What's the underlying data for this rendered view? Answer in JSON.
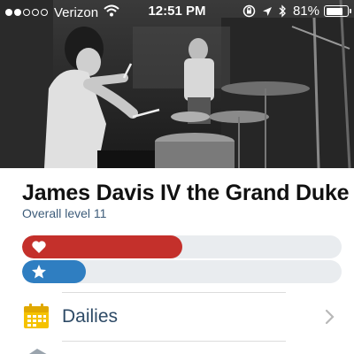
{
  "status_bar": {
    "carrier": "Verizon",
    "time": "12:51 PM",
    "battery": "81%",
    "battery_level": 0.81,
    "signal_bars_filled": 2,
    "signal_bars_total": 5,
    "icons": [
      "wifi-icon",
      "orientation-lock-icon",
      "location-arrow-icon",
      "bluetooth-icon",
      "battery-icon"
    ]
  },
  "header": {
    "photo": "drummer-photo"
  },
  "profile": {
    "name": "James Davis IV the Grand Duke",
    "level": "Overall level 11"
  },
  "bars": {
    "health": {
      "fraction": 0.5,
      "color": "#c4302b",
      "icon": "heart-icon"
    },
    "experience": {
      "fraction": 0.2,
      "color": "#2f7ec1",
      "icon": "star-icon"
    }
  },
  "menu": {
    "items": [
      {
        "label": "Dailies",
        "icon": "calendar-icon",
        "icon_color": "#f5c200"
      }
    ]
  },
  "colors": {
    "accent_text": "#3d5c7a",
    "menu_text": "#2d4a66"
  }
}
